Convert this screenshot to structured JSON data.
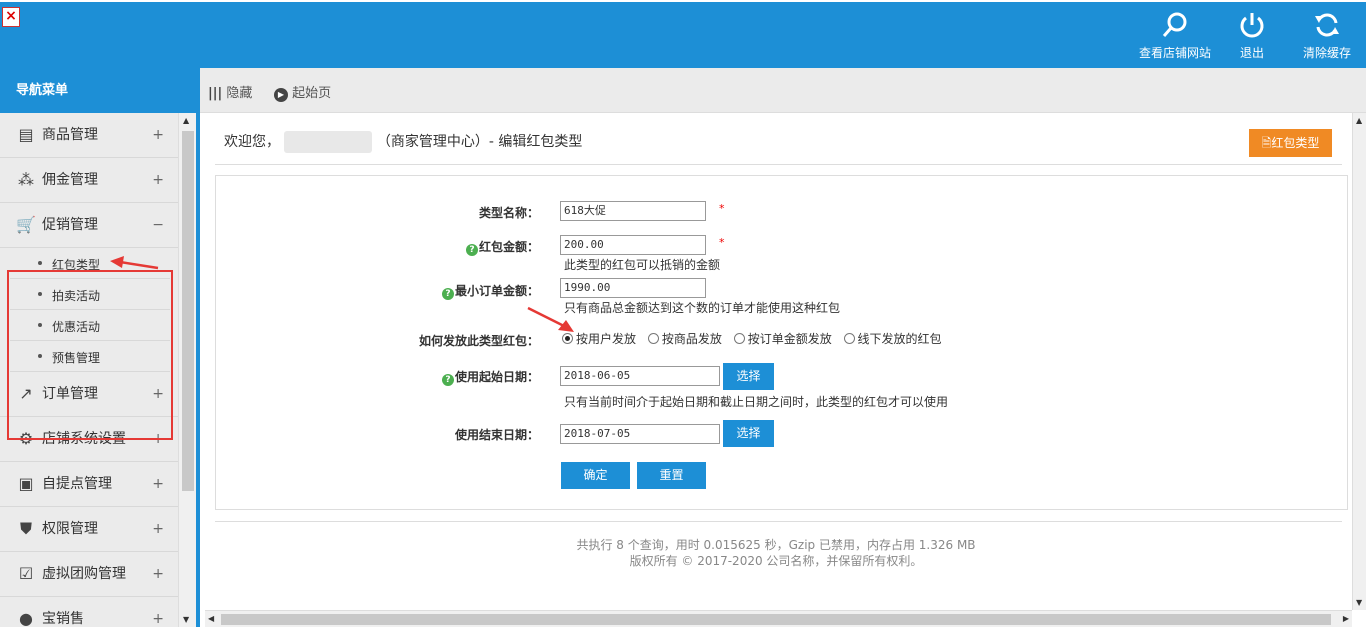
{
  "topbar": {
    "view_site_label": "查看店铺网站",
    "logout_label": "退出",
    "clear_cache_label": "清除缓存"
  },
  "sidebar": {
    "title": "导航菜单",
    "items": [
      {
        "label": "商品管理",
        "icon": "clipboard-icon",
        "sign": "+"
      },
      {
        "label": "佣金管理",
        "icon": "share-icon",
        "sign": "+"
      },
      {
        "label": "促销管理",
        "icon": "cart-icon",
        "sign": "−"
      },
      {
        "label": "订单管理",
        "icon": "export-icon",
        "sign": "+"
      },
      {
        "label": "店铺系统设置",
        "icon": "gears-icon",
        "sign": "+"
      },
      {
        "label": "自提点管理",
        "icon": "bag-icon",
        "sign": "+"
      },
      {
        "label": "权限管理",
        "icon": "shield-icon",
        "sign": "+"
      },
      {
        "label": "虚拟团购管理",
        "icon": "checkbox-icon",
        "sign": "+"
      },
      {
        "label": "宝销售",
        "icon": "chat-icon",
        "sign": "+"
      }
    ],
    "sub_items": [
      "红包类型",
      "拍卖活动",
      "优惠活动",
      "预售管理"
    ]
  },
  "toolbar": {
    "hide_label": "隐藏",
    "start_label": "起始页"
  },
  "content": {
    "welcome_prefix": "欢迎您，",
    "welcome_suffix": "（商家管理中心）- 编辑红包类型",
    "bonus_type_button": "红包类型"
  },
  "form": {
    "type_name_label": "类型名称：",
    "type_name_value": "618大促",
    "amount_label": "红包金额：",
    "amount_value": "200.00",
    "amount_hint": "此类型的红包可以抵销的金额",
    "min_order_label": "最小订单金额：",
    "min_order_value": "1990.00",
    "min_order_hint": "只有商品总金额达到这个数的订单才能使用这种红包",
    "send_type_label": "如何发放此类型红包：",
    "send_options": [
      "按用户发放",
      "按商品发放",
      "按订单金额发放",
      "线下发放的红包"
    ],
    "selected_option": "按用户发放",
    "start_date_label": "使用起始日期：",
    "start_date_value": "2018-06-05",
    "start_date_hint": "只有当前时间介于起始日期和截止日期之间时，此类型的红包才可以使用",
    "end_date_label": "使用结束日期：",
    "end_date_value": "2018-07-05",
    "select_label": "选择",
    "required_mark": "*",
    "confirm_label": "确定",
    "reset_label": "重置"
  },
  "footer": {
    "line1": "共执行 8 个查询，用时 0.015625 秒，Gzip 已禁用，内存占用 1.326 MB",
    "line2": "版权所有 © 2017-2020 公司名称，并保留所有权利。"
  },
  "colors": {
    "primary": "#1d8fd6",
    "orange": "#f08a24",
    "highlight": "#e53935"
  }
}
